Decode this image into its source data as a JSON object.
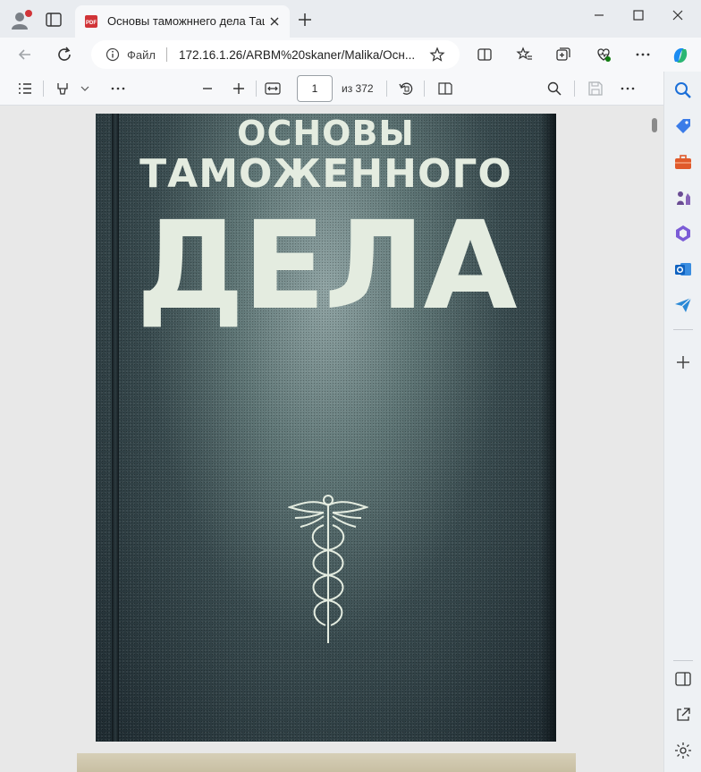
{
  "tab": {
    "title": "Основы таможннего дела Ташк"
  },
  "address": {
    "file_label": "Файл",
    "url": "172.16.1.26/ARBM%20skaner/Malika/Осн..."
  },
  "pdf_toolbar": {
    "page_current": "1",
    "page_total": "из 372"
  },
  "cover": {
    "line1": "ОСНОВЫ",
    "line2": "ТАМОЖЕННОГО",
    "line3": "ДЕЛА"
  },
  "colors": {
    "accent": "#0f6cbd",
    "cover_text": "#e4ece0"
  }
}
